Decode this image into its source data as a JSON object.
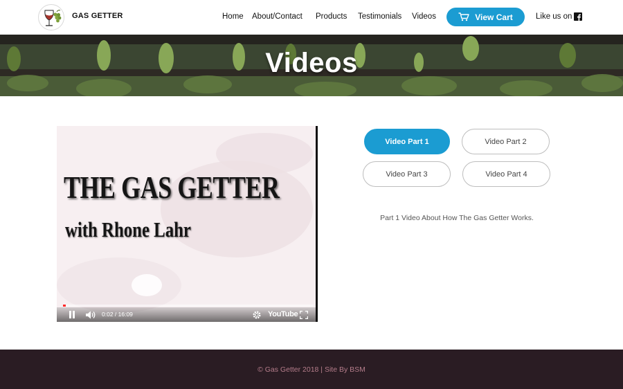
{
  "header": {
    "brand": "GAS GETTER",
    "nav": {
      "home": "Home",
      "about": "About/Contact",
      "products": "Products",
      "testimonials": "Testimonials",
      "videos": "Videos"
    },
    "cart_label": "View Cart",
    "like_label": "Like us on"
  },
  "hero": {
    "title": "Videos"
  },
  "video": {
    "title_line1": "THE GAS GETTER",
    "title_line2": "with Rhone Lahr",
    "time_display": "0:02 / 16:09",
    "progress_fraction": 0.002,
    "provider_logo": "YouTube"
  },
  "parts": {
    "buttons": [
      "Video Part 1",
      "Video Part 2",
      "Video Part 3",
      "Video Part 4"
    ],
    "active_index": 0,
    "description": "Part 1 Video About How The Gas Getter Works."
  },
  "footer": {
    "text": "© Gas Getter 2018 | Site By BSM"
  },
  "colors": {
    "accent": "#1b9cd2",
    "footer_bg": "#2a1c23",
    "footer_text": "#b57d8b"
  },
  "icons": {
    "logo": "wine-grape-logo",
    "cart": "shopping-cart-icon",
    "social": "facebook-icon",
    "play_state": "pause-icon",
    "volume": "volume-icon",
    "settings": "gear-icon",
    "fullscreen": "fullscreen-icon"
  }
}
